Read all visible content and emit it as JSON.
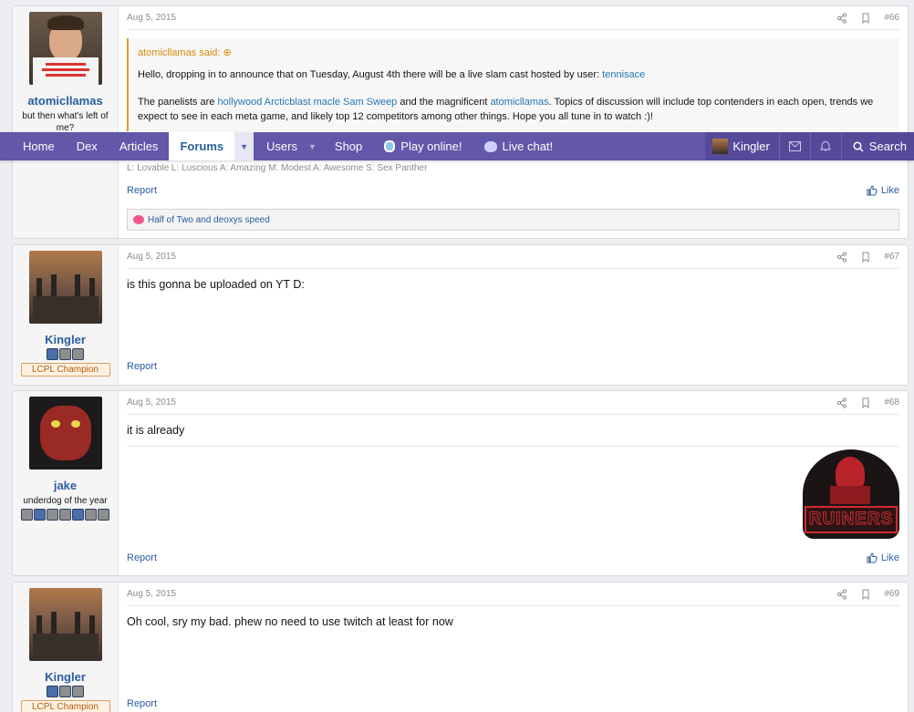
{
  "nav": {
    "home": "Home",
    "dex": "Dex",
    "articles": "Articles",
    "forums": "Forums",
    "users": "Users",
    "shop": "Shop",
    "play_online": "Play online!",
    "live_chat": "Live chat!",
    "user_name": "Kingler",
    "search": "Search"
  },
  "posts": [
    {
      "username": "atomicllamas",
      "user_title": "but then what's left of me?",
      "date": "Aug 5, 2015",
      "number": "#66",
      "quote_author": "atomicllamas said:",
      "quote_line1_a": "Hello, dropping in to announce that on Tuesday, August 4th there will be a live slam cast hosted by user: ",
      "quote_line1_link": "tennisace",
      "quote_line2_a": "The panelists are ",
      "quote_line2_link1": "hollywood Arcticblast macle Sam Sweep",
      "quote_line2_b": " and the magnificent ",
      "quote_line2_link2": "atomicllamas",
      "quote_line2_c": ". Topics of discussion will include top contenders in each open, trends we expect to see in each meta game, and likely top 12 competitors among other things. Hope you all tune in to watch :)!",
      "partial_text": "L: Lovable L: Luscious A: Amazing M: Modest A: Awesome S: Sex Panther",
      "report": "Report",
      "like": "Like",
      "signature": "Half of Two and deoxys speed"
    },
    {
      "username": "Kingler",
      "banner": "LCPL Champion",
      "date": "Aug 5, 2015",
      "number": "#67",
      "message": "is this gonna be uploaded on YT D:",
      "report": "Report"
    },
    {
      "username": "jake",
      "user_title": "underdog of the year",
      "date": "Aug 5, 2015",
      "number": "#68",
      "message": "it is already",
      "logo_text": "RUINERS",
      "report": "Report",
      "like": "Like"
    },
    {
      "username": "Kingler",
      "banner": "LCPL Champion",
      "date": "Aug 5, 2015",
      "number": "#69",
      "message": "Oh cool, sry my bad. phew no need to use twitch at least for now",
      "report": "Report"
    }
  ]
}
